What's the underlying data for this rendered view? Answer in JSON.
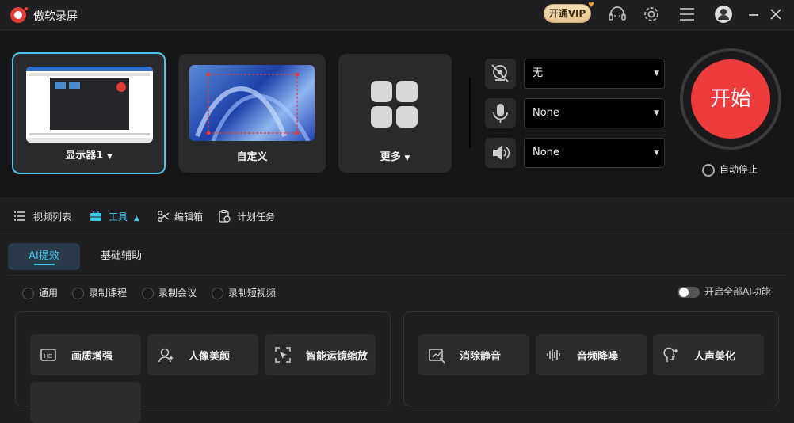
{
  "app": {
    "title": "傲软录屏",
    "vip_label": "开通VIP"
  },
  "colors": {
    "accent": "#3ec7ef",
    "start": "#ee3b3b",
    "vip": "#e6c38f"
  },
  "title_icons": [
    "headset-icon",
    "gear-icon",
    "menu-icon",
    "avatar",
    "minimize-icon",
    "close-icon"
  ],
  "sources": [
    {
      "label": "显示器1",
      "has_dropdown": true,
      "selected": true
    },
    {
      "label": "自定义",
      "has_dropdown": false,
      "selected": false
    },
    {
      "label": "更多",
      "has_dropdown": true,
      "selected": false
    }
  ],
  "devices": {
    "camera": {
      "value": "无",
      "icon": "camera-off-icon"
    },
    "microphone": {
      "value": "None",
      "icon": "microphone-icon"
    },
    "speaker": {
      "value": "None",
      "icon": "speaker-icon"
    }
  },
  "start_label": "开始",
  "auto_stop_label": "自动停止",
  "toolnav": [
    {
      "label": "视频列表",
      "icon": "list-icon",
      "active": false
    },
    {
      "label": "工具",
      "icon": "toolbox-icon",
      "active": true
    },
    {
      "label": "编辑箱",
      "icon": "scissors-icon",
      "active": false
    },
    {
      "label": "计划任务",
      "icon": "clipboard-clock-icon",
      "active": false
    }
  ],
  "subtabs": [
    {
      "label": "AI提效",
      "active": true
    },
    {
      "label": "基础辅助",
      "active": false
    }
  ],
  "modes": [
    "通用",
    "录制课程",
    "录制会议",
    "录制短视频"
  ],
  "enable_all_ai_label": "开启全部AI功能",
  "left_group": [
    {
      "label": "画质增强",
      "icon": "hd-icon"
    },
    {
      "label": "人像美颜",
      "icon": "beauty-icon"
    },
    {
      "label": "智能运镜缩放",
      "icon": "cursor-zoom-icon"
    }
  ],
  "right_group": [
    {
      "label": "消除静音",
      "icon": "mute-remove-icon"
    },
    {
      "label": "音频降噪",
      "icon": "waveform-icon"
    },
    {
      "label": "人声美化",
      "icon": "voice-beautify-icon"
    }
  ]
}
